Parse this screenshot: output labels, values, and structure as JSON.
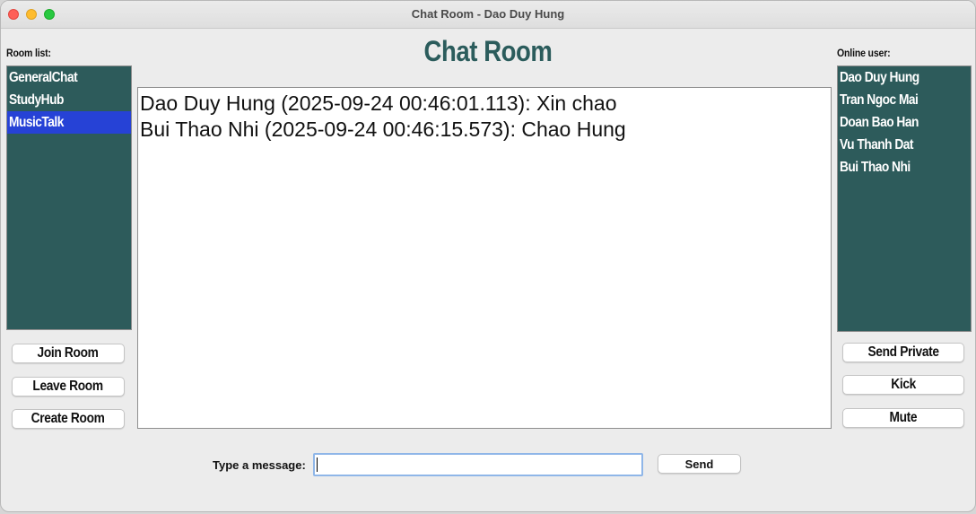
{
  "window": {
    "title": "Chat Room - Dao Duy Hung"
  },
  "heading": "Chat Room",
  "rooms": {
    "label": "Room list:",
    "items": [
      {
        "name": "GeneralChat",
        "selected": false
      },
      {
        "name": "StudyHub",
        "selected": false
      },
      {
        "name": "MusicTalk",
        "selected": true
      }
    ],
    "buttons": {
      "join": "Join Room",
      "leave": "Leave Room",
      "create": "Create Room"
    }
  },
  "users": {
    "label": "Online user:",
    "items": [
      "Dao Duy Hung",
      "Tran Ngoc Mai",
      "Doan Bao Han",
      "Vu Thanh Dat",
      "Bui Thao Nhi"
    ],
    "buttons": {
      "send_private": "Send Private",
      "kick": "Kick",
      "mute": "Mute"
    }
  },
  "messages": [
    "Dao Duy Hung (2025-09-24 00:46:01.113): Xin chao",
    "Bui Thao Nhi (2025-09-24 00:46:15.573): Chao Hung"
  ],
  "composer": {
    "label": "Type a message:",
    "value": "",
    "send_label": "Send"
  },
  "colors": {
    "list_bg": "#2d5b5b",
    "selected": "#2642d6",
    "heading": "#2b5c5c"
  }
}
